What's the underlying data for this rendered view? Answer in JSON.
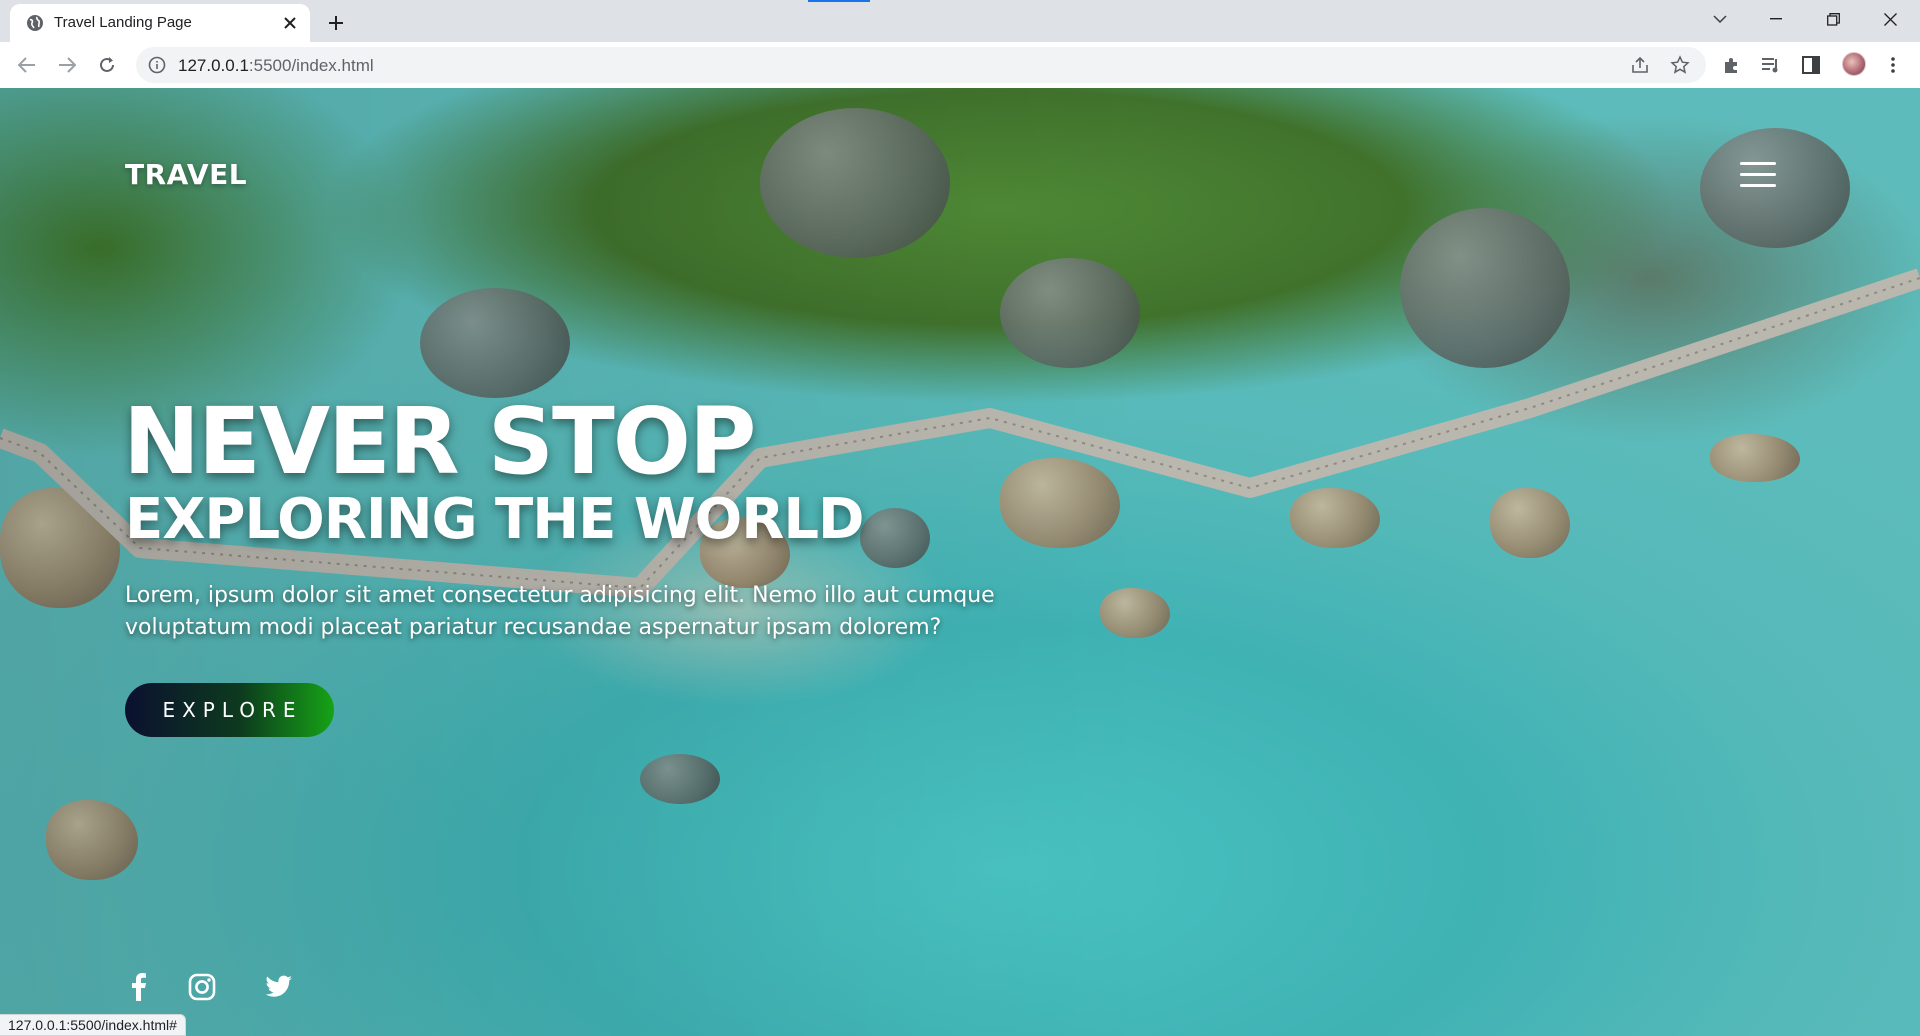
{
  "browser": {
    "tab": {
      "title": "Travel Landing Page",
      "favicon": "globe-icon"
    },
    "url": {
      "host": "127.0.0.1",
      "rest": ":5500/index.html"
    },
    "status_url": "127.0.0.1:5500/index.html#"
  },
  "site": {
    "logo": "TRAVEL",
    "menu_icon": "hamburger-menu-icon",
    "hero": {
      "title": "NEVER STOP",
      "subtitle": "EXPLORING THE WORLD",
      "text": "Lorem, ipsum dolor sit amet consectetur adipisicing elit. Nemo illo aut cumque voluptatum modi placeat pariatur recusandae aspernatur ipsam dolorem?",
      "button_label": "EXPLORE"
    },
    "social": [
      {
        "name": "facebook-icon"
      },
      {
        "name": "instagram-icon"
      },
      {
        "name": "twitter-icon"
      }
    ]
  },
  "colors": {
    "tab_strip": "#dee1e6",
    "omnibox": "#f1f3f4",
    "button_start": "#0b1030",
    "button_end": "#16a316"
  }
}
